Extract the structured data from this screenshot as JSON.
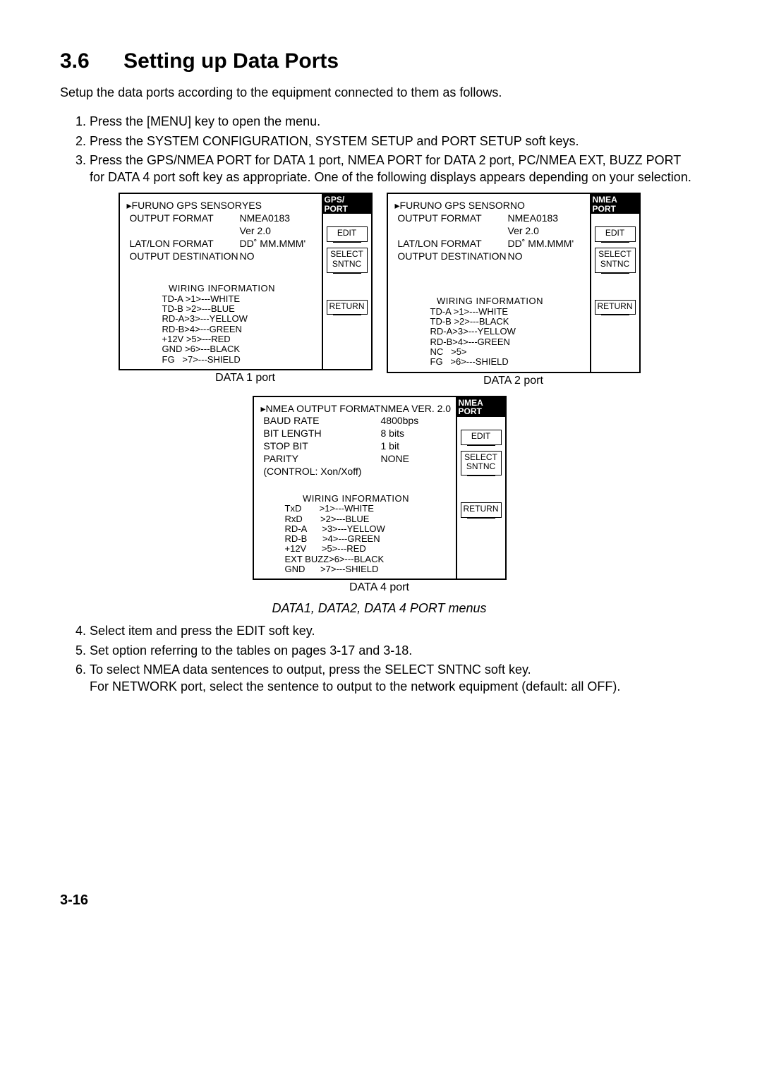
{
  "heading_number": "3.6",
  "heading_title": "Setting up Data Ports",
  "intro": "Setup the data ports according to the equipment connected to them as follows.",
  "steps_top": [
    "Press the [MENU] key to open the menu.",
    "Press the SYSTEM CONFIGURATION, SYSTEM SETUP and PORT SETUP soft keys.",
    "Press the GPS/NMEA PORT for DATA 1 port, NMEA PORT for DATA 2 port, PC/NMEA EXT, BUZZ PORT for DATA 4 port soft key as appropriate. One of the following displays appears depending on your selection."
  ],
  "screen1": {
    "side_header": "GPS/\n       PORT",
    "rows": [
      {
        "label": "▸FURUNO GPS SENSOR",
        "value": "YES"
      },
      {
        "label": "OUTPUT FORMAT",
        "value": "NMEA0183"
      },
      {
        "label": "",
        "value": "Ver 2.0"
      },
      {
        "label": "LAT/LON FORMAT",
        "value": "DD˚ MM.MMM'"
      },
      {
        "label": "OUTPUT DESTINATION",
        "value": "NO"
      }
    ],
    "wiring_title": "WIRING INFORMATION",
    "wiring": "TD-A >1>---WHITE\nTD-B >2>---BLUE\nRD-A>3>---YELLOW\nRD-B>4>---GREEN\n+12V >5>---RED\nGND >6>---BLACK\nFG   >7>---SHIELD",
    "softkeys": {
      "edit": "EDIT",
      "select": "SELECT\nSNTNC",
      "ret": "RETURN"
    },
    "caption": "DATA 1 port"
  },
  "screen2": {
    "side_header": "NMEA\n       PORT",
    "rows": [
      {
        "label": "▸FURUNO GPS SENSOR",
        "value": "NO"
      },
      {
        "label": "OUTPUT FORMAT",
        "value": "NMEA0183"
      },
      {
        "label": "",
        "value": "Ver 2.0"
      },
      {
        "label": "LAT/LON FORMAT",
        "value": "DD˚ MM.MMM'"
      },
      {
        "label": "OUTPUT DESTINATION",
        "value": "NO"
      }
    ],
    "wiring_title": "WIRING INFORMATION",
    "wiring": "TD-A >1>---WHITE\nTD-B >2>---BLACK\nRD-A>3>---YELLOW\nRD-B>4>---GREEN\nNC   >5>\nFG   >6>---SHIELD",
    "softkeys": {
      "edit": "EDIT",
      "select": "SELECT\nSNTNC",
      "ret": "RETURN"
    },
    "caption": "DATA 2 port"
  },
  "screen4": {
    "side_header": "NMEA\n       PORT",
    "rows": [
      {
        "label": "▸NMEA OUTPUT FORMAT",
        "value": "NMEA VER. 2.0"
      },
      {
        "label": "BAUD RATE",
        "value": "4800bps"
      },
      {
        "label": "BIT LENGTH",
        "value": "8 bits"
      },
      {
        "label": "STOP BIT",
        "value": "1 bit"
      },
      {
        "label": "PARITY",
        "value": "NONE"
      },
      {
        "label": "",
        "value": ""
      },
      {
        "label": "(CONTROL: Xon/Xoff)",
        "value": ""
      }
    ],
    "wiring_title": "WIRING INFORMATION",
    "wiring": "TxD       >1>---WHITE\nRxD       >2>---BLUE\nRD-A      >3>---YELLOW\nRD-B      >4>---GREEN\n+12V      >5>---RED\nEXT BUZZ>6>---BLACK\nGND      >7>---SHIELD",
    "softkeys": {
      "edit": "EDIT",
      "select": "SELECT\nSNTNC",
      "ret": "RETURN"
    },
    "caption": "DATA 4 port"
  },
  "figure_caption": "DATA1, DATA2, DATA 4 PORT menus",
  "steps_bottom": [
    "Select item and press the EDIT soft key.",
    "Set option referring to the tables on pages 3-17 and 3-18.",
    "To select NMEA data sentences to output, press the SELECT SNTNC soft key.\nFor NETWORK port, select the sentence to output to the network equipment (default: all OFF)."
  ],
  "page_number": "3-16"
}
